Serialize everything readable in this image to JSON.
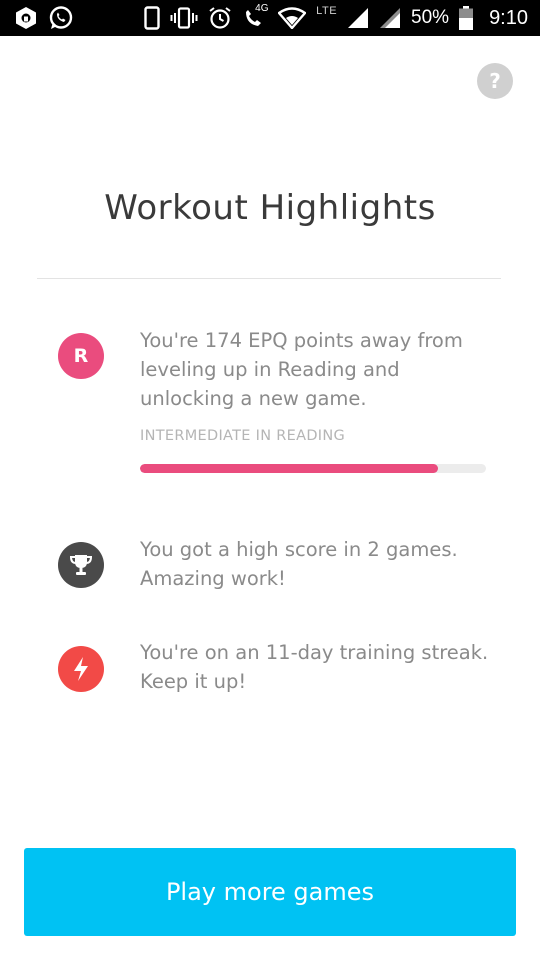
{
  "status_bar": {
    "icons_left": [
      "shield-app-icon",
      "whatsapp-icon"
    ],
    "icons_right": [
      "phone-icon",
      "vibrate-icon",
      "alarm-icon",
      "volte-call-icon",
      "wifi-icon",
      "signal-icon",
      "signal-icon-2",
      "battery-icon"
    ],
    "network_label": "LTE",
    "call_label": "4G",
    "battery_percent": "50%",
    "time": "9:10"
  },
  "header": {
    "help_label": "?",
    "title": "Workout Highlights"
  },
  "highlights": [
    {
      "icon": "reading-letter-icon",
      "icon_letter": "R",
      "icon_color": "#ea4c7e",
      "text": "You're 174 EPQ points away from leveling up in Reading and unlocking a new game.",
      "level_label": "INTERMEDIATE IN READING",
      "progress": 0.86,
      "progress_color": "#ea4c7e"
    },
    {
      "icon": "trophy-icon",
      "icon_color": "#4a4a4a",
      "text": "You got a high score in 2 games. Amazing work!"
    },
    {
      "icon": "lightning-bolt-icon",
      "icon_color": "#f24a47",
      "text": "You're on an 11-day training streak. Keep it up!"
    }
  ],
  "cta": {
    "label": "Play more games",
    "color": "#00c2f3"
  }
}
